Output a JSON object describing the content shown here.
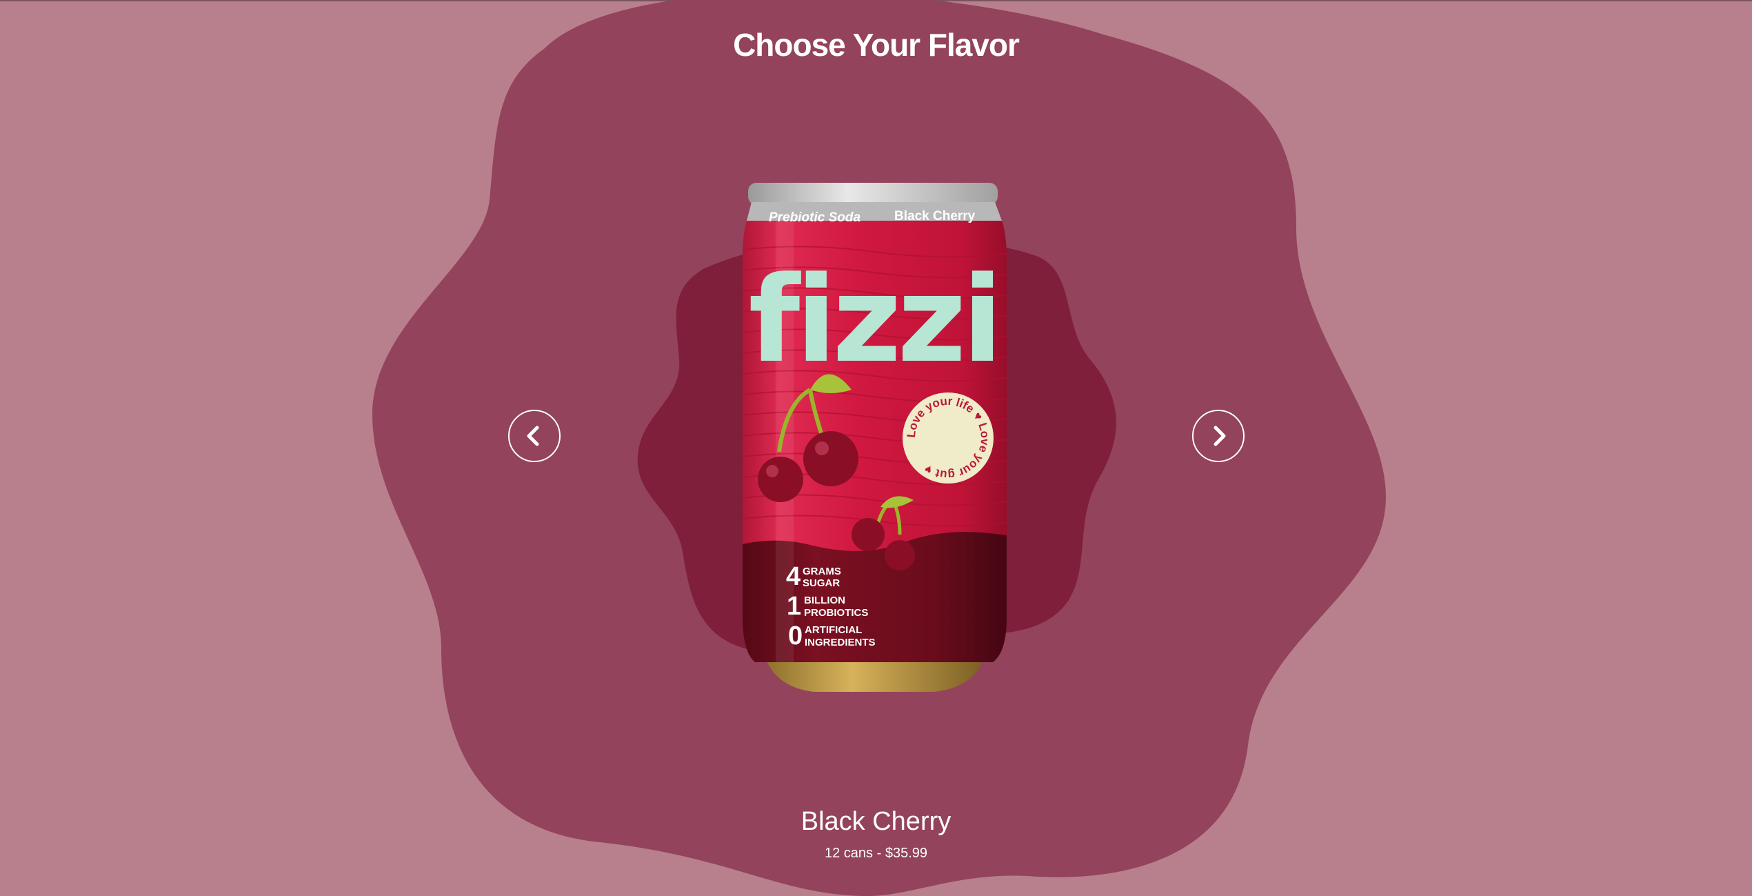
{
  "page": {
    "heading": "Choose Your Flavor"
  },
  "colors": {
    "background": "#b8808d",
    "outer_blob": "#93435b",
    "inner_blob": "#7f1f3c",
    "text": "#ffffff"
  },
  "carousel": {
    "prev_icon": "chevron-left-icon",
    "next_icon": "chevron-right-icon"
  },
  "can": {
    "brand": "fizzi",
    "top_left_text": "Prebiotic Soda",
    "top_right_text": "Black Cherry",
    "badge_text": "Love your life ♥ Love your gut ♥",
    "stats": [
      {
        "number": "4",
        "line1": "GRAMS",
        "line2": "SUGAR"
      },
      {
        "number": "1",
        "line1": "BILLION",
        "line2": "PROBIOTICS"
      },
      {
        "number": "0",
        "line1": "ARTIFICIAL",
        "line2": "INGREDIENTS"
      }
    ],
    "colors": {
      "body": "#d01840",
      "bottom": "#6e0b1c",
      "logo": "#b8e6d4",
      "badge": "#f0ebc8"
    }
  },
  "product": {
    "name": "Black Cherry",
    "price_line": "12 cans - $35.99"
  }
}
